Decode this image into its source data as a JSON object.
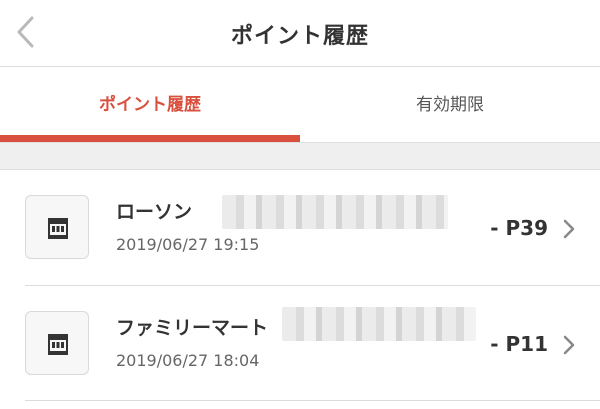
{
  "header": {
    "title": "ポイント履歴"
  },
  "tabs": [
    {
      "label": "ポイント履歴",
      "active": true
    },
    {
      "label": "有効期限",
      "active": false
    }
  ],
  "history": [
    {
      "store": "ローソン",
      "date": "2019/06/27 19:15",
      "points": "- P39"
    },
    {
      "store": "ファミリーマート",
      "date": "2019/06/27 18:04",
      "points": "- P11"
    }
  ],
  "colors": {
    "accent": "#d9503f"
  },
  "icons": {
    "back": "chevron-left-icon",
    "store": "store-icon",
    "row_arrow": "chevron-right-icon"
  }
}
